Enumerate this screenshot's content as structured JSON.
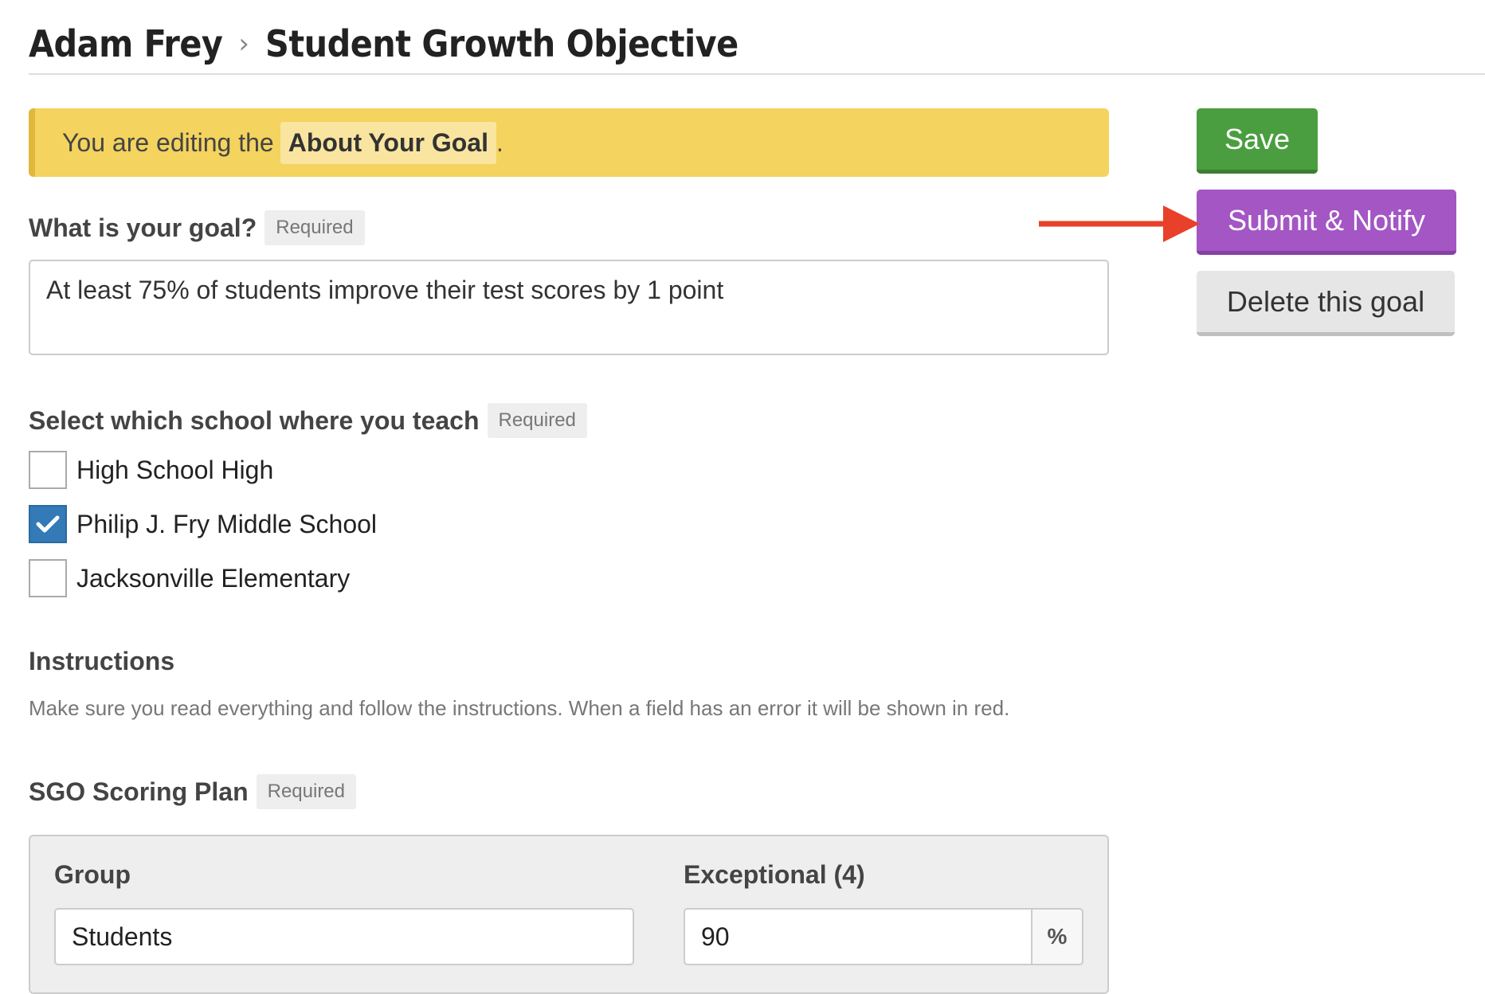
{
  "breadcrumb": {
    "parent": "Adam Frey",
    "separator": "›",
    "current": "Student Growth Objective"
  },
  "banner": {
    "prefix": "You are editing the",
    "highlight": "About Your Goal",
    "suffix": "."
  },
  "goal": {
    "label": "What is your goal?",
    "required": "Required",
    "value": "At least 75% of students improve their test scores by 1 point"
  },
  "school": {
    "label": "Select which school where you teach",
    "required": "Required",
    "options": [
      {
        "label": "High School High",
        "checked": false
      },
      {
        "label": "Philip J. Fry Middle School",
        "checked": true
      },
      {
        "label": "Jacksonville Elementary",
        "checked": false
      }
    ]
  },
  "instructions": {
    "title": "Instructions",
    "text": "Make sure you read everything and follow the instructions. When a field has an error it will be shown in red."
  },
  "scoring": {
    "label": "SGO Scoring Plan",
    "required": "Required",
    "group_label": "Group",
    "group_value": "Students",
    "exceptional_label": "Exceptional (4)",
    "exceptional_value": "90",
    "unit": "%"
  },
  "actions": {
    "save": "Save",
    "submit": "Submit & Notify",
    "delete": "Delete this goal"
  },
  "colors": {
    "banner": "#f4d35e",
    "save": "#4a9e3f",
    "submit": "#a356c4",
    "delete": "#e6e6e6",
    "checkbox_checked": "#337ab7",
    "arrow": "#e8402a"
  }
}
